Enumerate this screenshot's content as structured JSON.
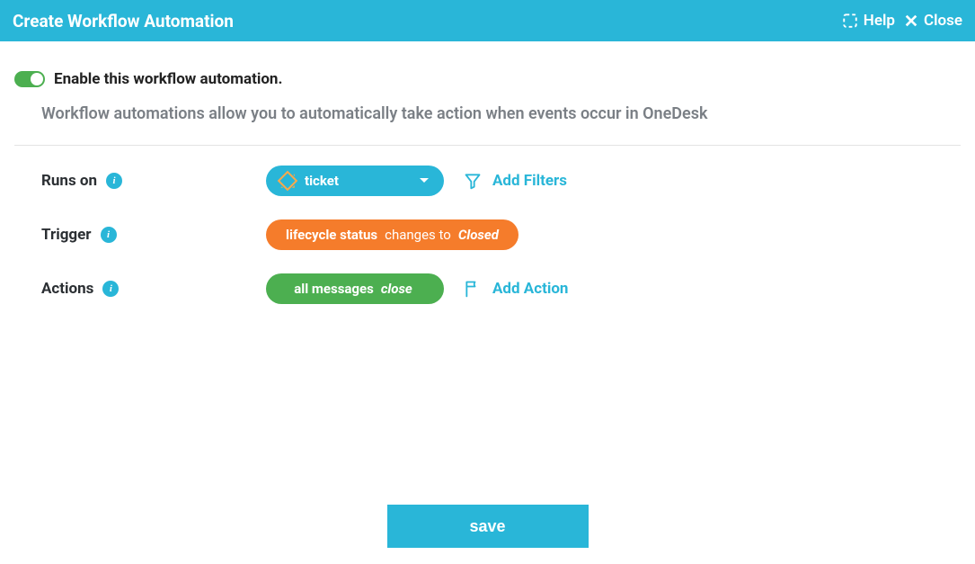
{
  "titlebar": {
    "title": "Create Workflow Automation",
    "help_label": "Help",
    "close_label": "Close"
  },
  "enable": {
    "label": "Enable this workflow automation.",
    "enabled": true
  },
  "description": "Workflow automations allow you to automatically take action when events occur in OneDesk",
  "rows": {
    "runs_on": {
      "label": "Runs on",
      "value": "ticket",
      "add_link": "Add Filters"
    },
    "trigger": {
      "label": "Trigger",
      "field": "lifecycle status",
      "operator": "changes to",
      "value": "Closed"
    },
    "actions": {
      "label": "Actions",
      "target": "all messages",
      "action": "close",
      "add_link": "Add Action"
    }
  },
  "footer": {
    "save_label": "save"
  }
}
